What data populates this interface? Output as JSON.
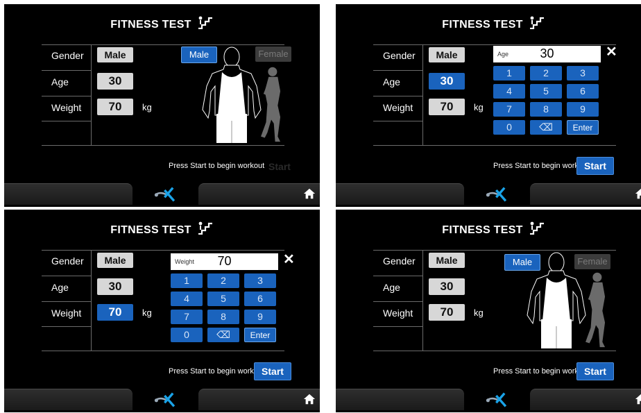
{
  "screens": [
    {
      "title": "FITNESS TEST",
      "labels": {
        "gender": "Gender",
        "age": "Age",
        "weight": "Weight"
      },
      "values": {
        "gender": "Male",
        "age": "30",
        "weight": "70"
      },
      "unit": "kg",
      "gender_options": {
        "male": "Male",
        "female": "Female"
      },
      "prompt": "Press Start to begin workout",
      "start_label": "Start"
    },
    {
      "title": "FITNESS TEST",
      "labels": {
        "gender": "Gender",
        "age": "Age",
        "weight": "Weight"
      },
      "values": {
        "gender": "Male",
        "age": "30",
        "weight": "70"
      },
      "unit": "kg",
      "keypad": {
        "field_label": "Age",
        "value": "30",
        "keys": [
          "1",
          "2",
          "3",
          "4",
          "5",
          "6",
          "7",
          "8",
          "9",
          "0",
          "⌫",
          "Enter"
        ]
      },
      "prompt": "Press Start to begin workout",
      "start_label": "Start"
    },
    {
      "title": "FITNESS TEST",
      "labels": {
        "gender": "Gender",
        "age": "Age",
        "weight": "Weight"
      },
      "values": {
        "gender": "Male",
        "age": "30",
        "weight": "70"
      },
      "unit": "kg",
      "keypad": {
        "field_label": "Weight",
        "value": "70",
        "keys": [
          "1",
          "2",
          "3",
          "4",
          "5",
          "6",
          "7",
          "8",
          "9",
          "0",
          "⌫",
          "Enter"
        ]
      },
      "prompt": "Press Start to begin workout",
      "start_label": "Start"
    },
    {
      "title": "FITNESS TEST",
      "labels": {
        "gender": "Gender",
        "age": "Age",
        "weight": "Weight"
      },
      "values": {
        "gender": "Male",
        "age": "30",
        "weight": "70"
      },
      "unit": "kg",
      "gender_options": {
        "male": "Male",
        "female": "Female"
      },
      "prompt": "Press Start to begin workout",
      "start_label": "Start"
    }
  ],
  "icons": {
    "title": "stairs-icon",
    "logo": "brand-logo-icon",
    "home": "home-icon",
    "close": "close-icon",
    "backspace": "backspace-icon"
  },
  "colors": {
    "background": "#000000",
    "accent": "#1a63bd",
    "field": "#d7d7d7",
    "divider": "#6b6b6b"
  }
}
